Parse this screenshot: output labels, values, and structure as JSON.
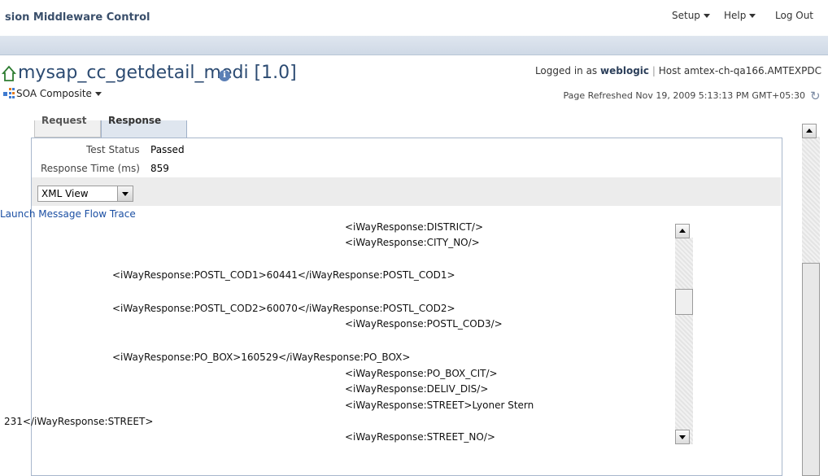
{
  "topbar": {
    "title": "sion Middleware Control",
    "links": [
      "Setup",
      "Help",
      "Log Out"
    ]
  },
  "header": {
    "target_name": "mysap_cc_getdetail_medi [1.0]",
    "info_glyph": "i",
    "type_menu": "SOA Composite",
    "logged_in_prefix": "Logged in as",
    "user": "weblogic",
    "host_prefix": "Host",
    "host": "amtex-ch-qa166.AMTEXPDC",
    "refreshed": "Page Refreshed Nov 19, 2009 5:13:13 PM GMT+05:30"
  },
  "tabs": [
    {
      "label": "Request"
    },
    {
      "label": "Response"
    }
  ],
  "results": {
    "test_status_label": "Test Status",
    "test_status_value": "Passed",
    "response_time_label": "Response Time (ms)",
    "response_time_value": "859",
    "view_selected": "XML View",
    "launch_link": "Launch Message Flow Trace"
  },
  "xml_lines": [
    "<iWayResponse:DISTRICT/>",
    "<iWayResponse:CITY_NO/>",
    "<iWayResponse:POSTL_COD1>60441</iWayResponse:POSTL_COD1>",
    "<iWayResponse:POSTL_COD2>60070</iWayResponse:POSTL_COD2>",
    "<iWayResponse:POSTL_COD3/>",
    "<iWayResponse:PO_BOX>160529</iWayResponse:PO_BOX>",
    "<iWayResponse:PO_BOX_CIT/>",
    "<iWayResponse:DELIV_DIS/>",
    "<iWayResponse:STREET>Lyoner Stern",
    "231</iWayResponse:STREET>",
    "<iWayResponse:STREET_NO/>"
  ],
  "icons": {
    "home": "home-icon",
    "info": "info-icon",
    "soa": "soa-composite-icon",
    "refresh": "refresh-icon"
  },
  "colors": {
    "title_blue": "#2c4b72",
    "link_blue": "#1b4fa3",
    "header_strip": "#dfe6ef"
  }
}
